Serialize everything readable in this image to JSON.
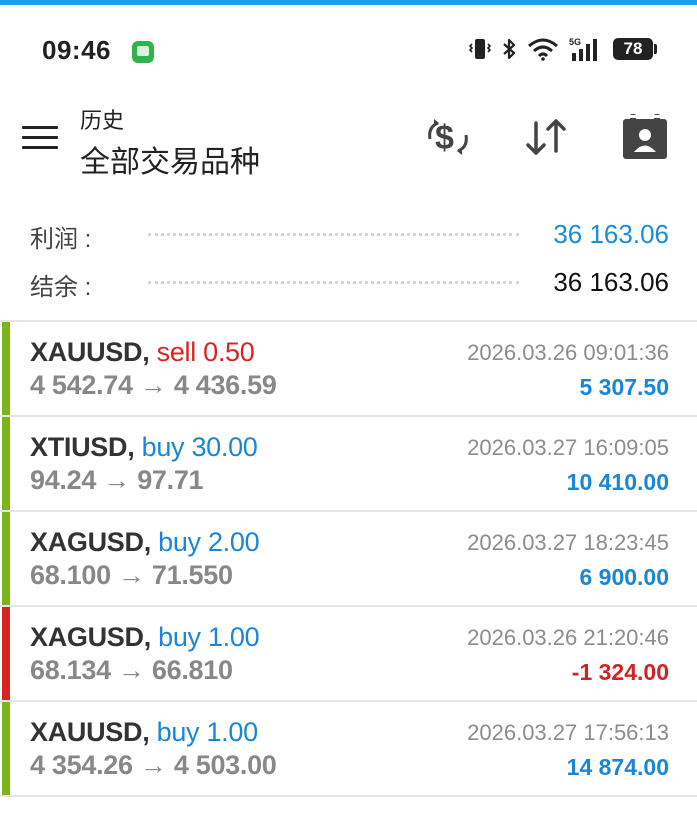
{
  "status_bar": {
    "time": "09:46",
    "battery": "78",
    "network": "5G"
  },
  "header": {
    "subtitle": "历史",
    "title": "全部交易品种"
  },
  "summary": {
    "profit_label": "利润 :",
    "profit_value": "36 163.06",
    "balance_label": "结余 :",
    "balance_value": "36 163.06"
  },
  "trades": [
    {
      "symbol": "XAUUSD,",
      "side": "sell",
      "side_text": "sell 0.50",
      "open": "4 542.74",
      "close": "4 436.59",
      "time": "2026.03.26 09:01:36",
      "profit": "5 307.50",
      "profit_sign": "pos",
      "bar_color": "#7cb518"
    },
    {
      "symbol": "XTIUSD,",
      "side": "buy",
      "side_text": "buy 30.00",
      "open": "94.24",
      "close": "97.71",
      "time": "2026.03.27 16:09:05",
      "profit": "10 410.00",
      "profit_sign": "pos",
      "bar_color": "#7cb518"
    },
    {
      "symbol": "XAGUSD,",
      "side": "buy",
      "side_text": "buy 2.00",
      "open": "68.100",
      "close": "71.550",
      "time": "2026.03.27 18:23:45",
      "profit": "6 900.00",
      "profit_sign": "pos",
      "bar_color": "#7cb518"
    },
    {
      "symbol": "XAGUSD,",
      "side": "buy",
      "side_text": "buy 1.00",
      "open": "68.134",
      "close": "66.810",
      "time": "2026.03.26 21:20:46",
      "profit": "-1 324.00",
      "profit_sign": "neg",
      "bar_color": "#d92424"
    },
    {
      "symbol": "XAUUSD,",
      "side": "buy",
      "side_text": "buy 1.00",
      "open": "4 354.26",
      "close": "4 503.00",
      "time": "2026.03.27 17:56:13",
      "profit": "14 874.00",
      "profit_sign": "pos",
      "bar_color": "#7cb518"
    }
  ],
  "colors": {
    "accent": "#1ea0f0",
    "buy": "#1a86d9",
    "sell": "#d92424",
    "profit_positive": "#1a86d9",
    "profit_negative": "#cf2424"
  },
  "icons": {
    "menu": "hamburger-menu-icon",
    "currency": "currency-exchange-icon",
    "sort": "sort-arrows-icon",
    "calendar": "calendar-person-icon"
  }
}
